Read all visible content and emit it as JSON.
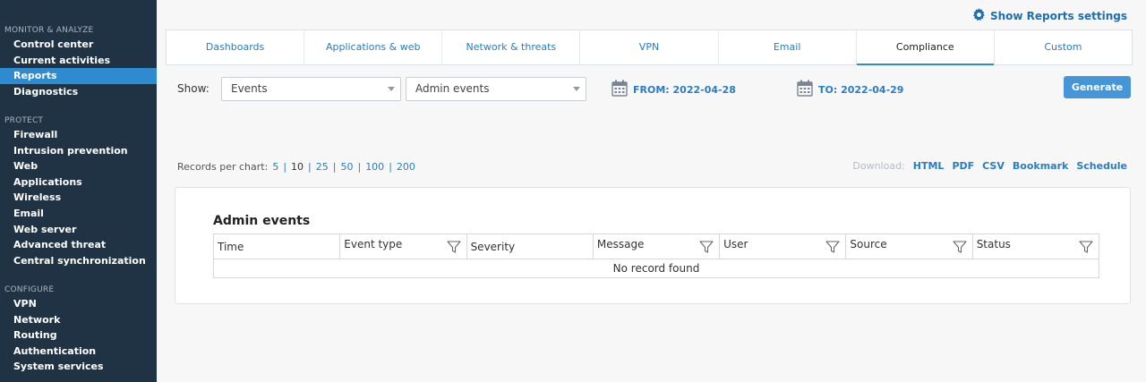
{
  "sidebar": {
    "sections": [
      {
        "title": "MONITOR & ANALYZE",
        "items": [
          "Control center",
          "Current activities",
          "Reports",
          "Diagnostics"
        ]
      },
      {
        "title": "PROTECT",
        "items": [
          "Firewall",
          "Intrusion prevention",
          "Web",
          "Applications",
          "Wireless",
          "Email",
          "Web server",
          "Advanced threat",
          "Central synchronization"
        ]
      },
      {
        "title": "CONFIGURE",
        "items": [
          "VPN",
          "Network",
          "Routing",
          "Authentication",
          "System services"
        ]
      }
    ],
    "active_item": "Reports"
  },
  "header": {
    "settings_label": "Show Reports settings",
    "settings_icon": "gear-icon"
  },
  "tabs": [
    "Dashboards",
    "Applications & web",
    "Network & threats",
    "VPN",
    "Email",
    "Compliance",
    "Custom"
  ],
  "active_tab": "Compliance",
  "controls": {
    "show_label": "Show:",
    "select_type": "Events",
    "select_report": "Admin events",
    "from_label": "FROM: 2022-04-28",
    "to_label": "TO: 2022-04-29",
    "generate_label": "Generate"
  },
  "records": {
    "label": "Records per chart:",
    "options": [
      "5",
      "10",
      "25",
      "50",
      "100",
      "200"
    ],
    "selected": "10"
  },
  "download": {
    "label": "Download:",
    "links": [
      "HTML",
      "PDF",
      "CSV",
      "Bookmark",
      "Schedule"
    ]
  },
  "report": {
    "title": "Admin events",
    "columns": [
      {
        "label": "Time",
        "filter": false
      },
      {
        "label": "Event type",
        "filter": true
      },
      {
        "label": "Severity",
        "filter": false
      },
      {
        "label": "Message",
        "filter": true
      },
      {
        "label": "User",
        "filter": true
      },
      {
        "label": "Source",
        "filter": true
      },
      {
        "label": "Status",
        "filter": true
      }
    ],
    "empty_text": "No record found"
  },
  "colors": {
    "sidebar_bg": "#1f3344",
    "accent": "#2f8bd0",
    "link": "#2a7dc4",
    "button": "#4595d9"
  }
}
